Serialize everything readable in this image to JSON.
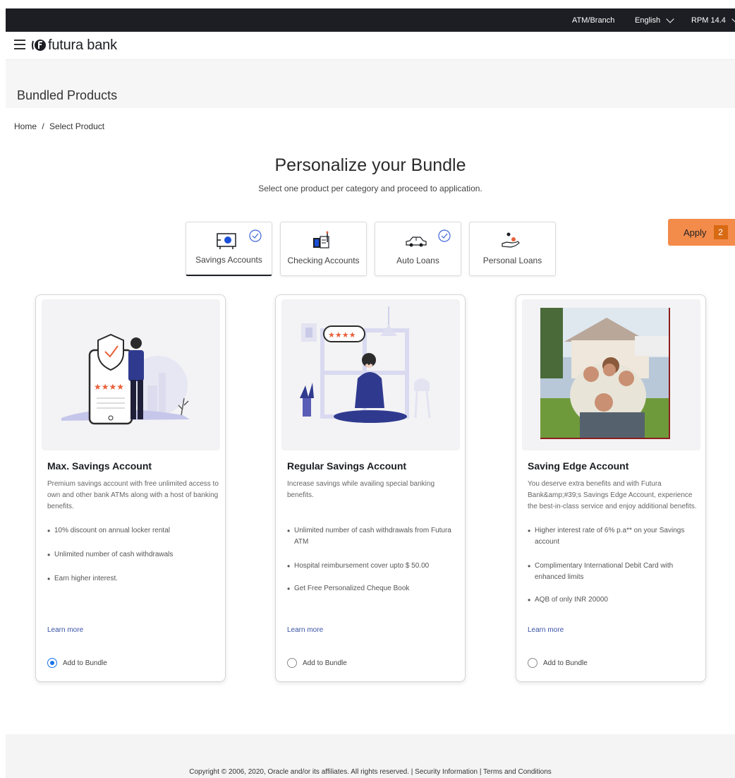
{
  "topbar": {
    "atm_branch": "ATM/Branch",
    "language": "English",
    "user": "RPM 14.4"
  },
  "header": {
    "logo_text": "futura bank"
  },
  "page": {
    "title": "Bundled Products",
    "breadcrumb_home": "Home",
    "breadcrumb_sep": "/",
    "breadcrumb_current": "Select Product",
    "hero_title": "Personalize your Bundle",
    "hero_subtitle": "Select one product per category and proceed to application."
  },
  "categories": [
    {
      "label": "Savings Accounts",
      "icon": "safe-icon",
      "selected": true
    },
    {
      "label": "Checking Accounts",
      "icon": "checkbook-icon",
      "selected": false
    },
    {
      "label": "Auto Loans",
      "icon": "car-icon",
      "selected": true
    },
    {
      "label": "Personal Loans",
      "icon": "hand-coins-icon",
      "selected": false
    }
  ],
  "apply": {
    "label": "Apply",
    "count": "2"
  },
  "products": [
    {
      "title": "Max. Savings Account",
      "description": "Premium savings account with free unlimited access to own and other bank ATMs along with a host of banking benefits.",
      "features": [
        "10% discount on annual locker rental",
        "Unlimited number of cash withdrawals",
        "Earn higher interest."
      ],
      "learn_more": "Learn more",
      "add_label": "Add to Bundle",
      "selected": true,
      "image": "secure-phone-illustration",
      "image_stars": "★★★★"
    },
    {
      "title": "Regular Savings Account",
      "description": "Increase savings while availing special banking benefits.",
      "features": [
        "Unlimited number of cash withdrawals from Futura ATM",
        "Hospital reimbursement cover upto $ 50.00",
        "Get Free Personalized Cheque Book"
      ],
      "learn_more": "Learn more",
      "add_label": "Add to Bundle",
      "selected": false,
      "image": "woman-with-phone-illustration",
      "image_stars": "★★★★"
    },
    {
      "title": "Saving Edge Account",
      "description": "You deserve extra benefits and with Futura Bank&amp;#39;s Savings Edge Account, experience the best-in-class service and enjoy additional benefits.",
      "features": [
        "Higher interest rate of 6% p.a** on your Savings account",
        "Complimentary International Debit Card with enhanced limits",
        "AQB of only INR 20000"
      ],
      "learn_more": "Learn more",
      "add_label": "Add to Bundle",
      "selected": false,
      "image": "family-photo"
    }
  ],
  "footer": {
    "text": "Copyright © 2006, 2020, Oracle and/or its affiliates. All rights reserved. | Security Information | Terms and Conditions"
  },
  "colors": {
    "topbar": "#1c1e23",
    "accent_orange": "#f38b4b",
    "badge_orange": "#d86a14",
    "radio_blue": "#1a73e8",
    "illustration_purple": "#c5c6ea",
    "illustration_blue": "#2f3a8f"
  }
}
